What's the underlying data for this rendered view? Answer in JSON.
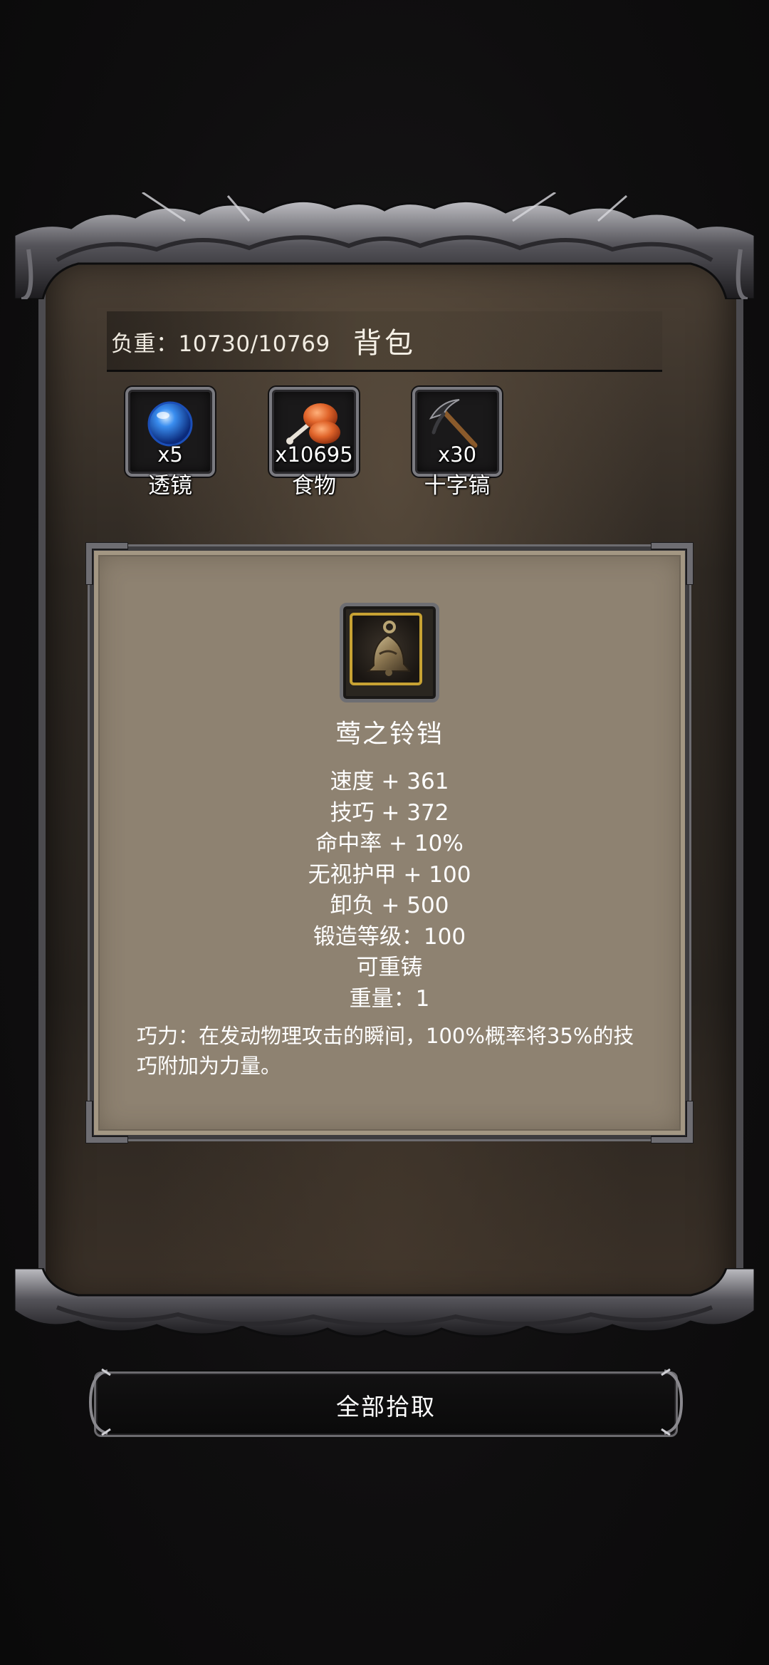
{
  "backpack": {
    "weight_label": "负重：10730/10769",
    "title": "背包"
  },
  "slots": [
    {
      "count": "x5",
      "name": "透镜",
      "icon": "lens-orb-icon"
    },
    {
      "count": "x10695",
      "name": "食物",
      "icon": "meat-drumstick-icon"
    },
    {
      "count": "x30",
      "name": "十字镐",
      "icon": "pickaxe-icon"
    }
  ],
  "detail": {
    "icon": "bell-icon",
    "name": "莺之铃铛",
    "stats": [
      "速度 + 361",
      "技巧 + 372",
      "命中率 + 10%",
      "无视护甲 + 100",
      "卸负 + 500",
      "锻造等级：100",
      "可重铸",
      "重量：1"
    ],
    "description": "巧力：在发动物理攻击的瞬间，100%概率将35%的技巧附加为力量。"
  },
  "actions": {
    "collect_all": "全部拾取"
  },
  "colors": {
    "panel_bg": "#2f2923",
    "card_bg": "#8e8271",
    "gold_border": "#c7a233",
    "frame_silver": "#7a7a80"
  }
}
